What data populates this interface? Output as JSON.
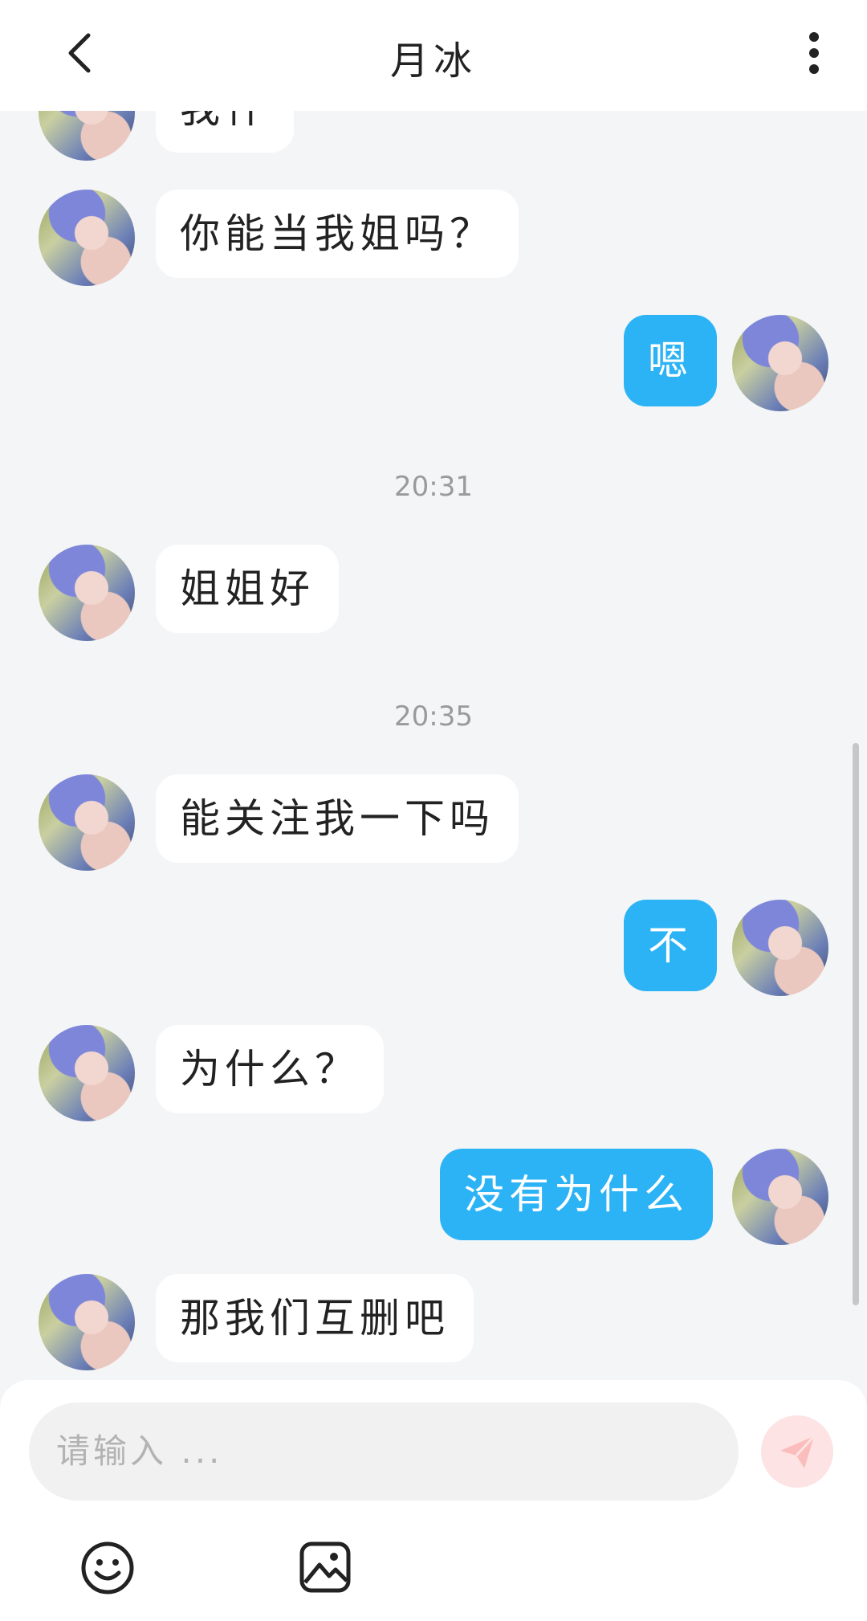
{
  "header": {
    "title": "月冰"
  },
  "messages": [
    {
      "side": "in",
      "text": "我什"
    },
    {
      "side": "in",
      "text": "你能当我姐吗？"
    },
    {
      "side": "out",
      "text": "嗯"
    },
    {
      "side": "in",
      "text": "姐姐好"
    },
    {
      "side": "in",
      "text": "能关注我一下吗"
    },
    {
      "side": "out",
      "text": "不"
    },
    {
      "side": "in",
      "text": "为什么？"
    },
    {
      "side": "out",
      "text": "没有为什么"
    },
    {
      "side": "in",
      "text": "那我们互删吧"
    }
  ],
  "timestamps": [
    "20:31",
    "20:35"
  ],
  "composer": {
    "placeholder": "请输入 ..."
  },
  "icons": {
    "back": "chevron-left-icon",
    "more": "more-vertical-icon",
    "send": "send-icon",
    "emoji": "smiley-icon",
    "image": "image-icon"
  },
  "colors": {
    "outgoing_bubble": "#2cb3f5",
    "incoming_bubble": "#ffffff",
    "background": "#f4f5f7",
    "send_button": "#fde3e3"
  }
}
